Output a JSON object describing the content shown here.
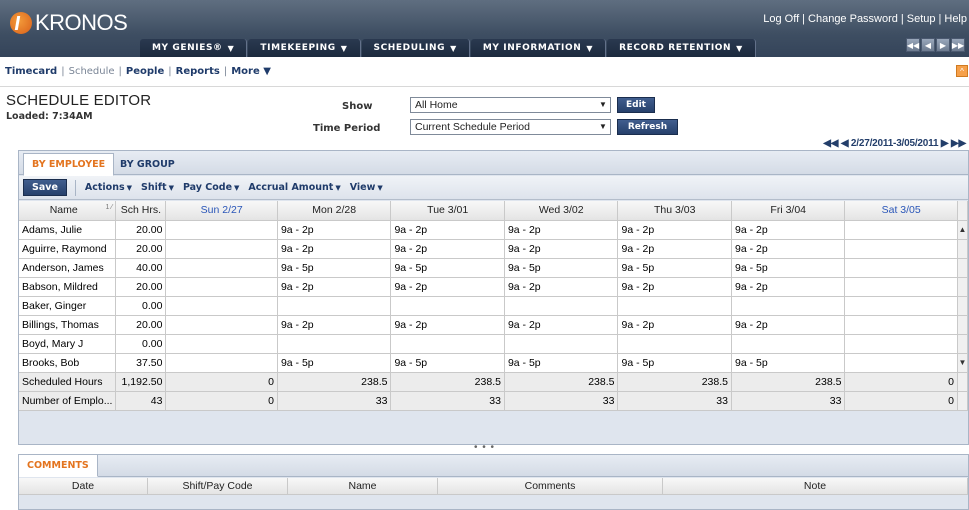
{
  "app": {
    "logo_text": "KRONOS",
    "top_links": [
      "Log Off",
      "Change Password",
      "Setup",
      "Help"
    ],
    "top_link_separator": "|",
    "main_nav": [
      {
        "label": "MY GENIES®"
      },
      {
        "label": "TIMEKEEPING"
      },
      {
        "label": "SCHEDULING"
      },
      {
        "label": "MY INFORMATION"
      },
      {
        "label": "RECORD RETENTION"
      }
    ],
    "pager_icons": [
      "first-page-icon",
      "prev-page-icon",
      "next-page-icon",
      "last-page-icon"
    ],
    "colors": {
      "header": "#3e4e62",
      "accent": "#e3741f",
      "link": "#1f3b6a",
      "weekend": "#2a56b8"
    }
  },
  "subnav": {
    "items": [
      {
        "label": "Timecard",
        "active": true
      },
      {
        "label": "Schedule",
        "active": false
      },
      {
        "label": "People",
        "active": true
      },
      {
        "label": "Reports",
        "active": true
      },
      {
        "label": "More ▼",
        "active": true
      }
    ]
  },
  "page": {
    "title": "SCHEDULE EDITOR",
    "loaded": "Loaded: 7:34AM",
    "show_label": "Show",
    "show_value": "All Home",
    "period_label": "Time Period",
    "period_value": "Current Schedule Period",
    "edit_label": "Edit",
    "refresh_label": "Refresh",
    "date_range": "2/27/2011-3/05/2011"
  },
  "editor": {
    "tabs": [
      {
        "label": "BY EMPLOYEE",
        "active": true
      },
      {
        "label": "BY GROUP",
        "active": false
      }
    ],
    "save_label": "Save",
    "menus": [
      "Actions",
      "Shift",
      "Pay Code",
      "Accrual Amount",
      "View"
    ],
    "columns": [
      {
        "label": "Name",
        "sort": "1 ⁄"
      },
      {
        "label": "Sch Hrs."
      },
      {
        "label": "Sun 2/27",
        "weekend": true
      },
      {
        "label": "Mon 2/28"
      },
      {
        "label": "Tue 3/01"
      },
      {
        "label": "Wed 3/02"
      },
      {
        "label": "Thu 3/03"
      },
      {
        "label": "Fri 3/04"
      },
      {
        "label": "Sat 3/05",
        "weekend": true
      }
    ],
    "rows": [
      {
        "name": "Adams, Julie",
        "hrs": "20.00",
        "days": [
          "",
          "9a - 2p",
          "9a - 2p",
          "9a - 2p",
          "9a - 2p",
          "9a - 2p",
          ""
        ]
      },
      {
        "name": "Aguirre, Raymond",
        "hrs": "20.00",
        "days": [
          "",
          "9a - 2p",
          "9a - 2p",
          "9a - 2p",
          "9a - 2p",
          "9a - 2p",
          ""
        ]
      },
      {
        "name": "Anderson, James",
        "hrs": "40.00",
        "days": [
          "",
          "9a - 5p",
          "9a - 5p",
          "9a - 5p",
          "9a - 5p",
          "9a - 5p",
          ""
        ]
      },
      {
        "name": "Babson, Mildred",
        "hrs": "20.00",
        "days": [
          "",
          "9a - 2p",
          "9a - 2p",
          "9a - 2p",
          "9a - 2p",
          "9a - 2p",
          ""
        ]
      },
      {
        "name": "Baker, Ginger",
        "hrs": "0.00",
        "days": [
          "",
          "",
          "",
          "",
          "",
          "",
          ""
        ]
      },
      {
        "name": "Billings, Thomas",
        "hrs": "20.00",
        "days": [
          "",
          "9a - 2p",
          "9a - 2p",
          "9a - 2p",
          "9a - 2p",
          "9a - 2p",
          ""
        ]
      },
      {
        "name": "Boyd, Mary J",
        "hrs": "0.00",
        "days": [
          "",
          "",
          "",
          "",
          "",
          "",
          ""
        ]
      },
      {
        "name": "Brooks, Bob",
        "hrs": "37.50",
        "days": [
          "",
          "9a - 5p",
          "9a - 5p",
          "9a - 5p",
          "9a - 5p",
          "9a - 5p",
          ""
        ]
      }
    ],
    "totals": [
      {
        "label": "Scheduled Hours",
        "hrs": "1,192.50",
        "days": [
          "0",
          "238.5",
          "238.5",
          "238.5",
          "238.5",
          "238.5",
          "0"
        ]
      },
      {
        "label": "Number of Emplo...",
        "hrs": "43",
        "days": [
          "0",
          "33",
          "33",
          "33",
          "33",
          "33",
          "0"
        ]
      }
    ]
  },
  "splitter": "• • •",
  "comments": {
    "tab_label": "COMMENTS",
    "columns": [
      "Date",
      "Shift/Pay Code",
      "Name",
      "Comments",
      "Note"
    ]
  }
}
